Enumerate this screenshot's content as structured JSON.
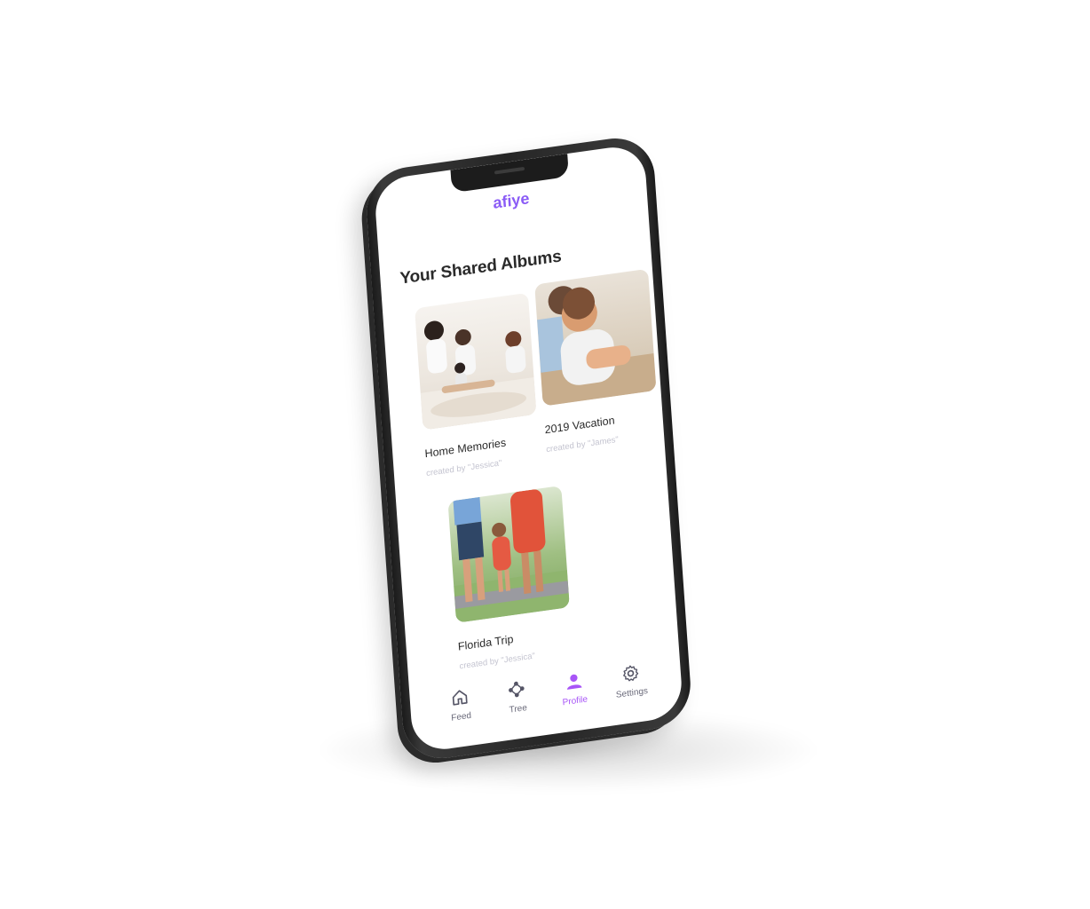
{
  "app": {
    "brand": "afiye"
  },
  "page": {
    "title": "Your Shared Albums"
  },
  "albums": [
    {
      "name": "Home Memories",
      "creator": "created by \"Jessica\""
    },
    {
      "name": "2019 Vacation",
      "creator": "created by \"James\""
    },
    {
      "name": "Florida Trip",
      "creator": "created by \"Jessica\""
    }
  ],
  "nav": {
    "items": [
      {
        "label": "Feed",
        "icon": "home-icon"
      },
      {
        "label": "Tree",
        "icon": "tree-icon"
      },
      {
        "label": "Profile",
        "icon": "profile-icon",
        "active": true
      },
      {
        "label": "Settings",
        "icon": "gear-icon"
      }
    ]
  },
  "colors": {
    "accent": "#8b5cf6",
    "active": "#a855f7"
  }
}
